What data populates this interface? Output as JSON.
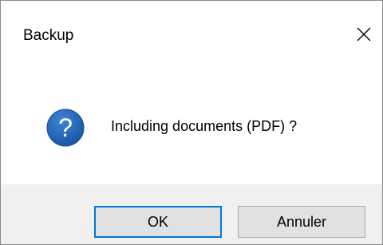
{
  "dialog": {
    "title": "Backup",
    "close_icon": "close-icon",
    "message_icon": "question-icon",
    "message": "Including documents (PDF) ?",
    "buttons": {
      "ok_label": "OK",
      "cancel_label": "Annuler"
    }
  },
  "colors": {
    "accent": "#0078d7",
    "icon_blue": "#1f5fad",
    "footer_bg": "#f0f0f0",
    "button_bg": "#e1e1e1"
  }
}
